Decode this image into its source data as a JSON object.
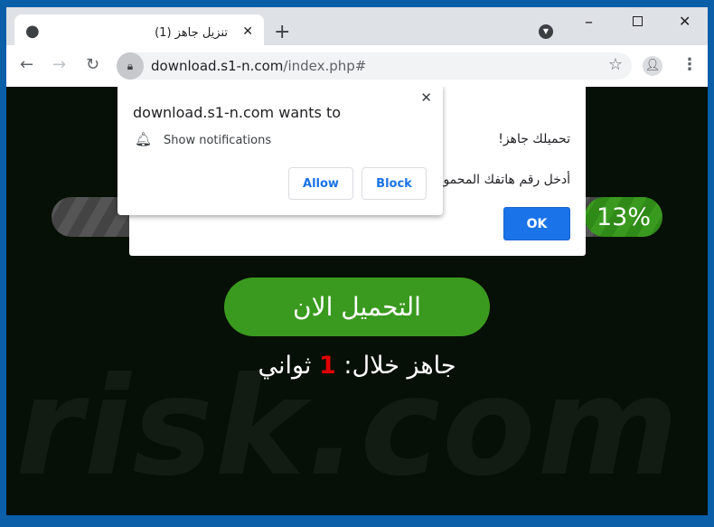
{
  "browser": {
    "tab_title": "(1) تنزيل جاهز",
    "url_domain": "download.s1-n.com",
    "url_path": "/index.php#"
  },
  "alert": {
    "line1": "تحميلك جاهز!",
    "line2": "أدخل رقم هاتفك المحمول",
    "ok_label": "OK"
  },
  "notification": {
    "title": "download.s1-n.com wants to",
    "permission": "Show notifications",
    "allow_label": "Allow",
    "block_label": "Block"
  },
  "progress": {
    "percent_label": "13%",
    "value": 13
  },
  "download_button": "التحميل الان",
  "countdown": {
    "prefix": "جاهز خلال:",
    "number": "1",
    "suffix": "ثواني"
  },
  "watermark": "risk.com",
  "colors": {
    "accent": "#1a73e8",
    "green": "#3a9a1f",
    "countdown_number": "#e00000"
  }
}
